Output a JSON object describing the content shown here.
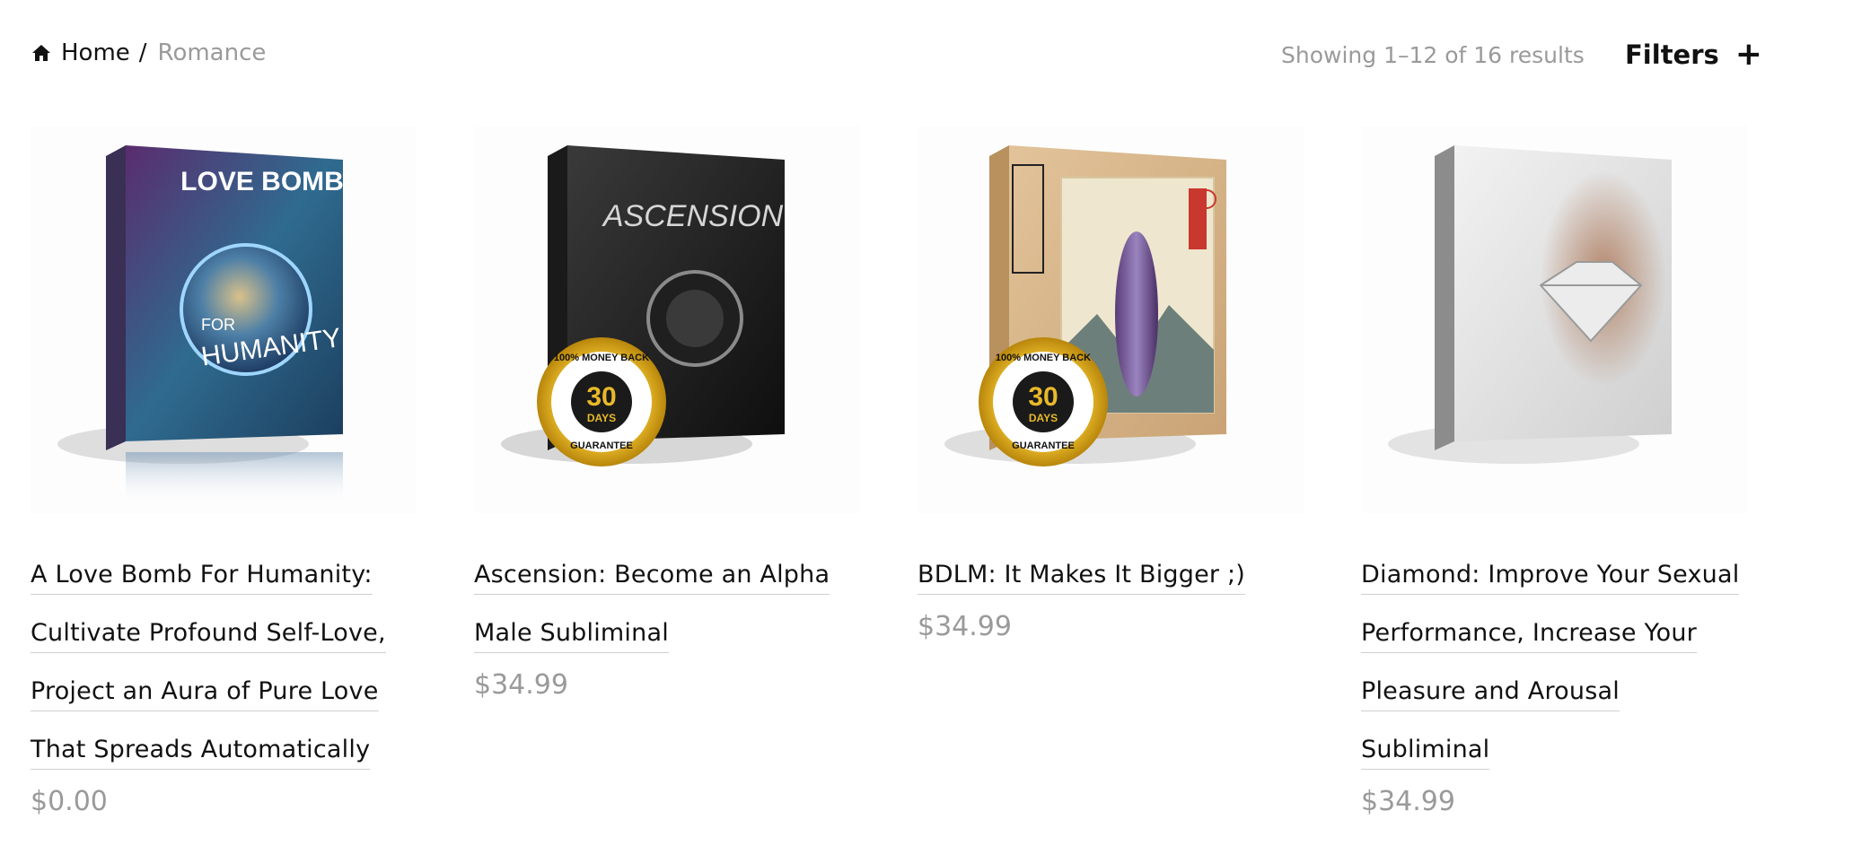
{
  "breadcrumb": {
    "home_label": "Home",
    "separator": "/",
    "current": "Romance"
  },
  "results_text": "Showing 1–12 of 16 results",
  "filters_label": "Filters",
  "filters_icon": "+",
  "products": [
    {
      "title": "A Love Bomb For Humanity: Cultivate Profound Self-Love, Project an Aura of Pure Love That Spreads Automatically",
      "price": "$0.00",
      "box": {
        "line1": "LOVE BOMB",
        "line2": "FOR",
        "line3": "HUMANITY"
      }
    },
    {
      "title": "Ascension: Become an Alpha Male Subliminal",
      "price": "$34.99",
      "box": {
        "line1": "ASCENSION"
      },
      "badge": {
        "top": "100% MONEY BACK",
        "number": "30",
        "unit": "DAYS",
        "bottom": "GUARANTEE"
      }
    },
    {
      "title": "BDLM: It Makes It Bigger ;)",
      "price": "$34.99",
      "badge": {
        "top": "100% MONEY BACK",
        "number": "30",
        "unit": "DAYS",
        "bottom": "GUARANTEE"
      }
    },
    {
      "title": "Diamond: Improve Your Sexual Performance, Increase Your Pleasure and Arousal Subliminal",
      "price": "$34.99"
    }
  ],
  "colors": {
    "muted": "#9a9a9a",
    "text": "#111111",
    "gold": "#e8b92a"
  }
}
